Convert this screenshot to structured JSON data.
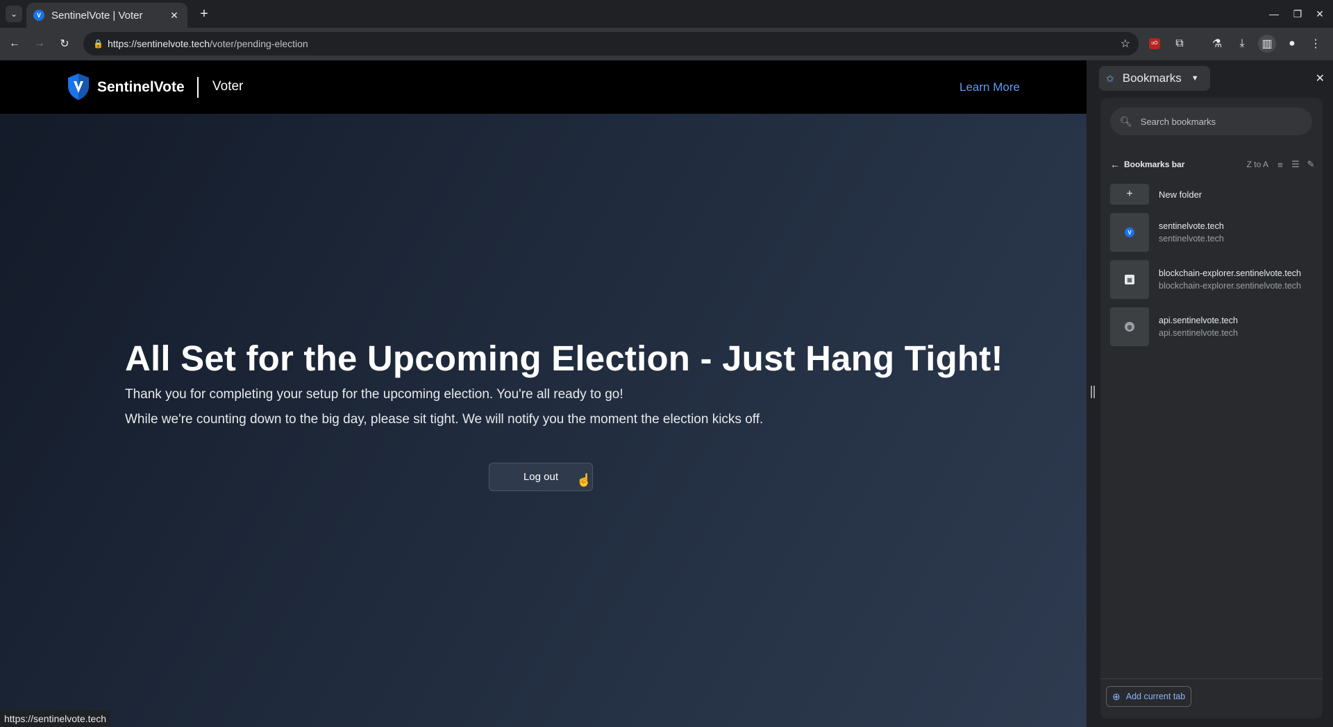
{
  "browser": {
    "tab": {
      "title": "SentinelVote | Voter",
      "favicon_letter": "V"
    },
    "url_host": "https://sentinelvote.tech",
    "url_path": "/voter/pending-election",
    "status_url": "https://sentinelvote.tech"
  },
  "site": {
    "brand": "SentinelVote",
    "section": "Voter",
    "shield_letter": "V",
    "learn_more": "Learn More",
    "accent_color": "#1a73e8"
  },
  "hero": {
    "title": "All Set for the Upcoming Election - Just Hang Tight!",
    "line1": "Thank you for completing your setup for the upcoming election. You're all ready to go!",
    "line2": "While we're counting down to the big day, please sit tight. We will notify you the moment the election kicks off.",
    "logout": "Log out"
  },
  "bookmarks_panel": {
    "title": "Bookmarks",
    "search_placeholder": "Search bookmarks",
    "folder": "Bookmarks bar",
    "sort": "Z to A",
    "new_folder": "New folder",
    "items": [
      {
        "title": "sentinelvote.tech",
        "url": "sentinelvote.tech",
        "icon": "shield-v-icon"
      },
      {
        "title": "blockchain-explorer.sentinelvote.tech",
        "url": "blockchain-explorer.sentinelvote.tech",
        "icon": "grid-icon"
      },
      {
        "title": "api.sentinelvote.tech",
        "url": "api.sentinelvote.tech",
        "icon": "globe-icon"
      }
    ],
    "add_current_tab": "Add current tab"
  }
}
